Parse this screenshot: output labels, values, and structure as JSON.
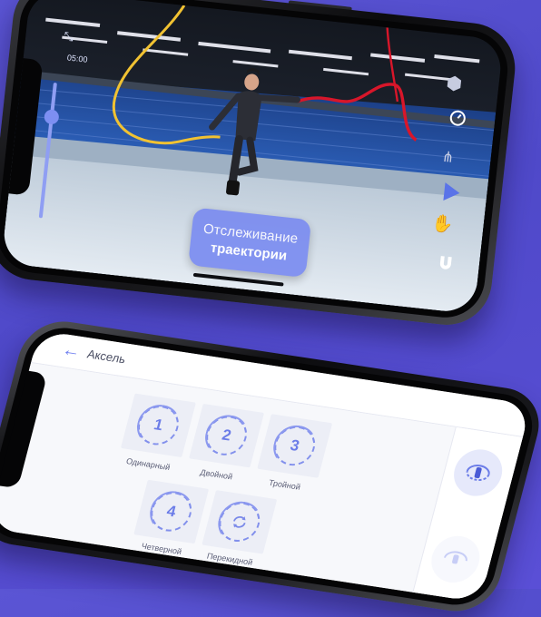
{
  "tracking_screen": {
    "timer": "05:00",
    "cta_line1": "Отслеживание",
    "cta_line2": "траектории",
    "icons": [
      "collapse-icon",
      "cube-icon",
      "speedometer-icon",
      "skeleton-icon",
      "play-icon",
      "hand-icon",
      "magnet-icon"
    ],
    "path_colors": {
      "left_trail": "#f1c232",
      "right_trail": "#d8162a"
    }
  },
  "jumps_screen": {
    "title": "Аксель",
    "back_icon": "back-arrow-icon",
    "rotations": [
      {
        "number": "1",
        "label": "Одинарный"
      },
      {
        "number": "2",
        "label": "Двойной"
      },
      {
        "number": "3",
        "label": "Тройной"
      },
      {
        "number": "4",
        "label": "Четверной"
      },
      {
        "number": "",
        "label": "Перекидной"
      }
    ],
    "side_buttons": [
      "skater-rotation-icon",
      "skater-rotation-faded-icon"
    ],
    "accent": "#6c7de8"
  }
}
